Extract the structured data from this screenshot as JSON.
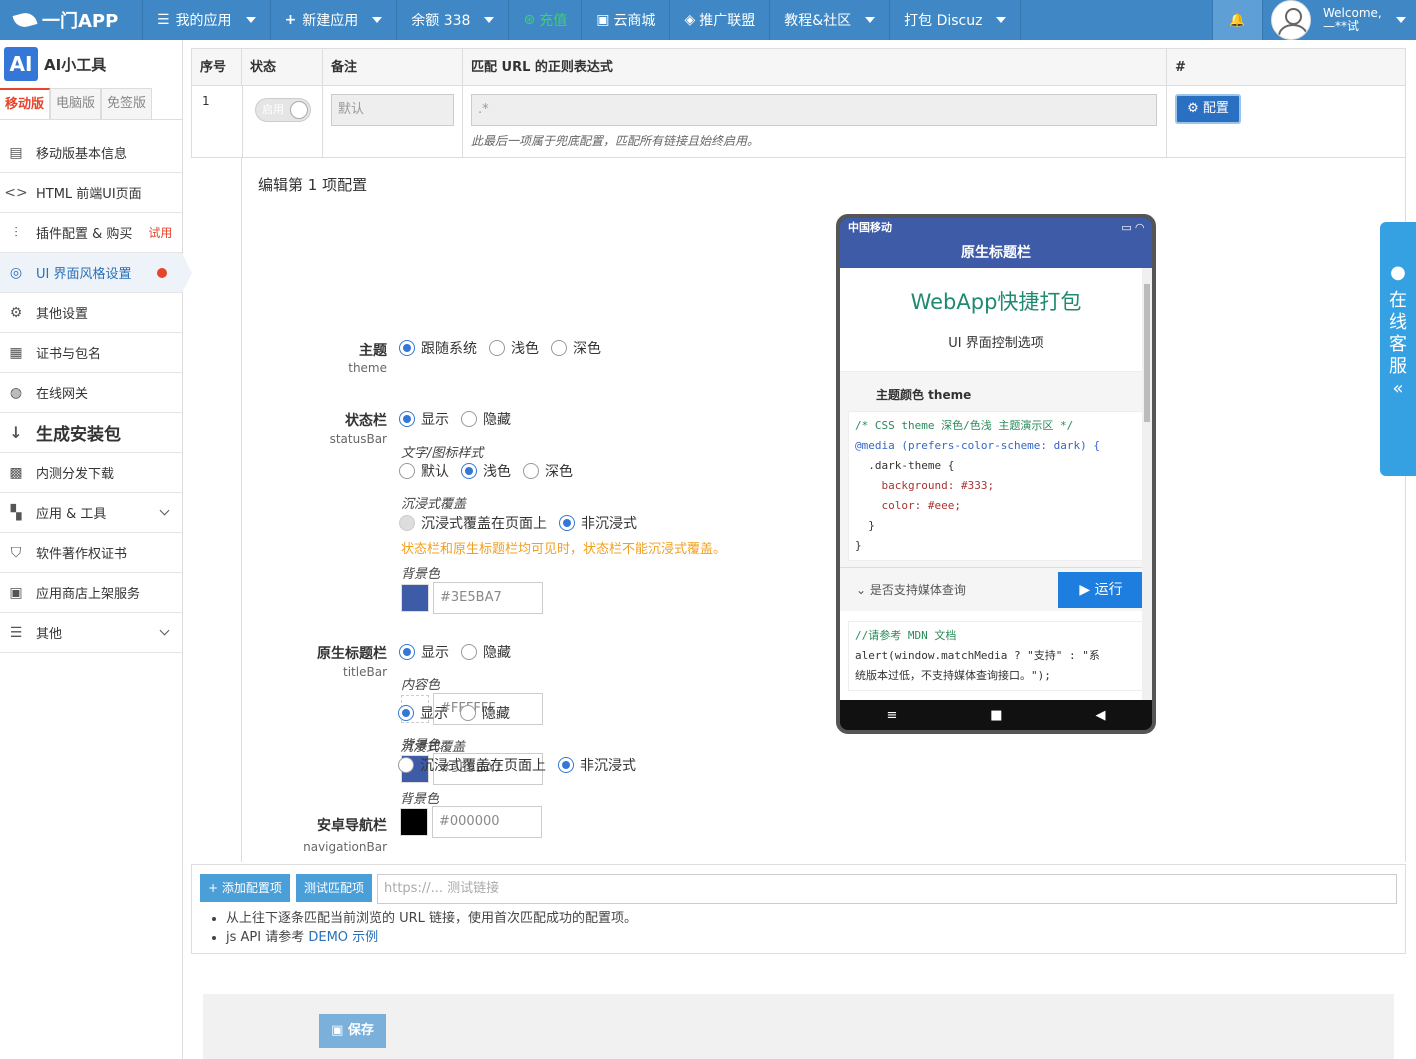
{
  "nav": {
    "brand": "一门APP",
    "my_apps": "我的应用",
    "new_app": "新建应用",
    "balance": "余额 338",
    "recharge": "充值",
    "cloud_store": "云商城",
    "affiliate": "推广联盟",
    "tutorial": "教程&社区",
    "pack_discuz": "打包 Discuz",
    "welcome": "Welcome,",
    "user": "—**试"
  },
  "sidebar": {
    "app_icon": "AI",
    "app_name": "AI小工具",
    "tabs": [
      "移动版",
      "电脑版",
      "免签版"
    ],
    "items": [
      {
        "label": "移动版基本信息",
        "icon": "doc-icon"
      },
      {
        "label": "HTML 前端UI页面",
        "icon": "code-icon"
      },
      {
        "label": "插件配置 & 购买",
        "icon": "sliders-icon",
        "badge": "试用"
      },
      {
        "label": "UI 界面风格设置",
        "icon": "palette-icon"
      },
      {
        "label": "其他设置",
        "icon": "gear-icon"
      },
      {
        "label": "证书与包名",
        "icon": "certificate-icon"
      },
      {
        "label": "在线网关",
        "icon": "gateway-icon"
      },
      {
        "label": "生成安装包",
        "icon": "sort-icon"
      },
      {
        "label": "内测分发下载",
        "icon": "qrcode-icon"
      },
      {
        "label": "应用 & 工具",
        "icon": "apps-icon"
      },
      {
        "label": "软件著作权证书",
        "icon": "shield-icon"
      },
      {
        "label": "应用商店上架服务",
        "icon": "store-icon"
      },
      {
        "label": "其他",
        "icon": "bars-icon"
      }
    ]
  },
  "table": {
    "headers": [
      "序号",
      "状态",
      "备注",
      "匹配 URL 的正则表达式",
      "#"
    ],
    "row": {
      "index": "1",
      "status": "启用",
      "remark": "默认",
      "regex": ".*",
      "config_btn": "配置",
      "hint": "此最后一项属于兜底配置，匹配所有链接且始终启用。"
    }
  },
  "edit": {
    "title": "编辑第 1 项配置",
    "theme": {
      "label": "主题",
      "sub": "theme",
      "options": [
        "跟随系统",
        "浅色",
        "深色"
      ]
    },
    "statusbar": {
      "label": "状态栏",
      "sub": "statusBar",
      "options": [
        "显示",
        "隐藏"
      ],
      "text_style_label": "文字/图标样式",
      "text_style_options": [
        "默认",
        "浅色",
        "深色"
      ],
      "immersive_label": "沉浸式覆盖",
      "immersive_options": [
        "沉浸式覆盖在页面上",
        "非沉浸式"
      ],
      "warning": "状态栏和原生标题栏均可见时，状态栏不能沉浸式覆盖。",
      "bg_label": "背景色",
      "bg_value": "#3E5BA7"
    },
    "titlebar": {
      "label": "原生标题栏",
      "sub": "titleBar",
      "options": [
        "显示",
        "隐藏"
      ],
      "content_label": "内容色",
      "content_value": "#FFFFFF",
      "bg_label": "背景色",
      "bg_value": "#3E5BA7"
    },
    "navbar": {
      "label": "安卓导航栏",
      "sub": "navigationBar",
      "options": [
        "显示",
        "隐藏"
      ],
      "immersive_label": "沉浸式覆盖",
      "immersive_options": [
        "沉浸式覆盖在页面上",
        "非沉浸式"
      ],
      "bg_label": "背景色",
      "bg_value": "#000000"
    }
  },
  "phone": {
    "carrier": "中国移动",
    "title": "原生标题栏",
    "heading": "WebApp快捷打包",
    "subheading": "UI 界面控制选项",
    "section": "主题颜色 theme",
    "code_lines": [
      "/* CSS theme 深色/色浅 主题演示区 */",
      "@media (prefers-color-scheme: dark) {",
      "  .dark-theme {",
      "    background: #333;",
      "    color: #eee;",
      "  }",
      "}"
    ],
    "media_query": "是否支持媒体查询",
    "run": "运行",
    "code2_line1": "//请参考 MDN 文档",
    "code2_line2": "alert(window.matchMedia ? \"支持\" : \"系",
    "code2_line3": "统版本过低，不支持媒体查询接口。\");",
    "nav_icons": [
      "≡",
      "■",
      "◀"
    ]
  },
  "bottom": {
    "add_btn": "添加配置项",
    "test_btn": "测试匹配项",
    "test_placeholder": "https://... 测试链接",
    "note1": "从上往下逐条匹配当前浏览的 URL 链接，使用首次匹配成功的配置项。",
    "note2_prefix": "js API 请参考",
    "note2_link": "DEMO 示例",
    "save": "保存"
  },
  "service": {
    "label": "在线客服"
  },
  "colors": {
    "nav": "#3f88c5",
    "accent": "#3477d6",
    "warning": "#f0a020",
    "red": "#e8442b"
  }
}
